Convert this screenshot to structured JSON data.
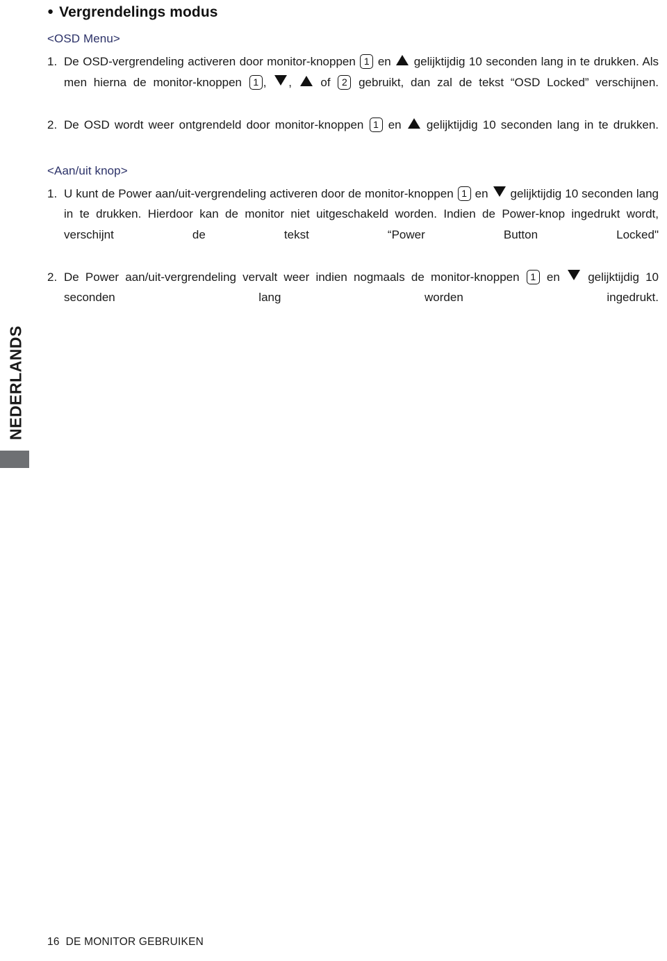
{
  "page": {
    "language_tab": "NEDERLANDS",
    "footer_page_number": "16",
    "footer_title": "DE MONITOR GEBRUIKEN",
    "footer_text": "16  DE MONITOR GEBRUIKEN",
    "colors": {
      "sub_heading": "#2b3168",
      "body_text": "#1a1a1a",
      "tab_marker": "#6e7073"
    }
  },
  "heading": {
    "bullet": "●",
    "text": "Vergrendelings modus"
  },
  "sections": [
    {
      "title": "<OSD Menu>",
      "items": [
        {
          "marker": "1.",
          "parts": [
            {
              "type": "text",
              "value": "De OSD-vergrendeling activeren door monitor-knoppen "
            },
            {
              "type": "key",
              "value": "1"
            },
            {
              "type": "text",
              "value": " en "
            },
            {
              "type": "icon",
              "value": "triangle-up-icon"
            },
            {
              "type": "text",
              "value": " gelijktijdig 10 seconden lang in te drukken. Als men hierna de monitor-knoppen "
            },
            {
              "type": "key",
              "value": "1"
            },
            {
              "type": "text",
              "value": ", "
            },
            {
              "type": "icon",
              "value": "triangle-down-icon"
            },
            {
              "type": "text",
              "value": ", "
            },
            {
              "type": "icon",
              "value": "triangle-up-icon"
            },
            {
              "type": "text",
              "value": " of "
            },
            {
              "type": "key",
              "value": "2"
            },
            {
              "type": "text",
              "value": " gebruikt, dan zal de tekst “OSD Locked” verschijnen."
            }
          ]
        },
        {
          "marker": "2.",
          "parts": [
            {
              "type": "text",
              "value": "De OSD wordt weer ontgrendeld door monitor-knoppen "
            },
            {
              "type": "key",
              "value": "1"
            },
            {
              "type": "text",
              "value": " en "
            },
            {
              "type": "icon",
              "value": "triangle-up-icon"
            },
            {
              "type": "text",
              "value": " gelijktijdig 10 seconden lang in te drukken."
            }
          ]
        }
      ]
    },
    {
      "title": "<Aan/uit knop>",
      "items": [
        {
          "marker": "1.",
          "parts": [
            {
              "type": "text",
              "value": "U kunt de Power aan/uit-vergrendeling activeren door de monitor-knoppen "
            },
            {
              "type": "key",
              "value": "1"
            },
            {
              "type": "text",
              "value": " en "
            },
            {
              "type": "icon",
              "value": "triangle-down-icon"
            },
            {
              "type": "text",
              "value": " gelijktijdig 10 seconden lang in te drukken. Hierdoor kan de monitor niet uitgeschakeld worden. Indien de Power-knop ingedrukt wordt, verschijnt de tekst “Power Button Locked\""
            }
          ]
        },
        {
          "marker": "2.",
          "parts": [
            {
              "type": "text",
              "value": "De Power aan/uit-vergrendeling vervalt weer indien nogmaals de monitor-knoppen "
            },
            {
              "type": "key",
              "value": "1"
            },
            {
              "type": "text",
              "value": " en "
            },
            {
              "type": "icon",
              "value": "triangle-down-icon"
            },
            {
              "type": "text",
              "value": " gelijktijdig 10 seconden lang worden ingedrukt."
            }
          ]
        }
      ]
    }
  ]
}
